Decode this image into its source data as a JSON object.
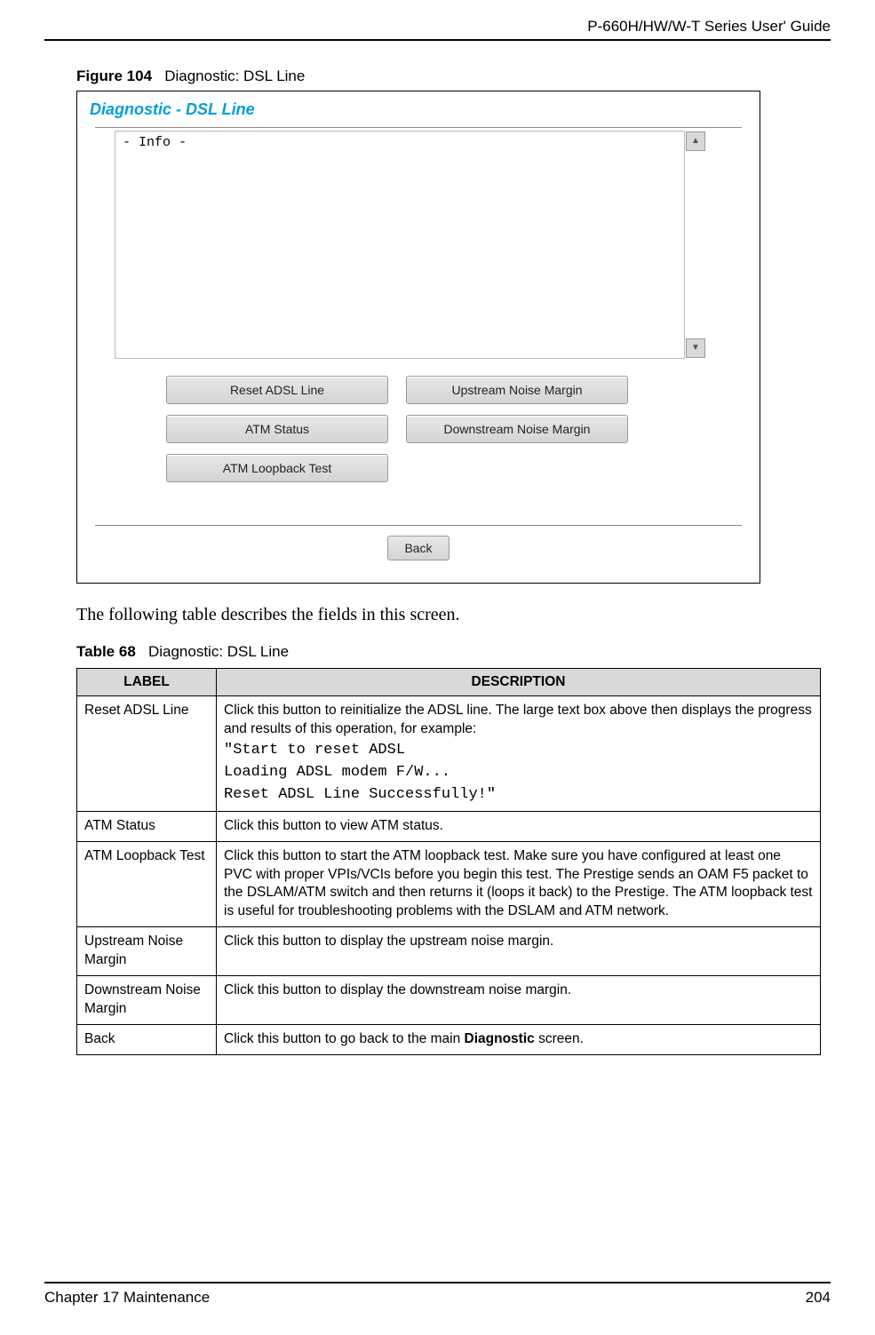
{
  "header": {
    "guide_title": "P-660H/HW/W-T Series User' Guide"
  },
  "figure": {
    "label": "Figure 104",
    "title": "Diagnostic: DSL Line",
    "panel_title": "Diagnostic - DSL Line",
    "info_text": "- Info -",
    "buttons": {
      "reset": "Reset ADSL Line",
      "upstream": "Upstream Noise Margin",
      "atm_status": "ATM Status",
      "downstream": "Downstream Noise Margin",
      "atm_loopback": "ATM Loopback Test",
      "back": "Back"
    },
    "scroll_up_glyph": "▲",
    "scroll_down_glyph": "▼"
  },
  "intro_text": "The following table describes the fields in this screen.",
  "table": {
    "label": "Table 68",
    "title": "Diagnostic: DSL Line",
    "headers": {
      "col1": "LABEL",
      "col2": "DESCRIPTION"
    },
    "rows": {
      "r0": {
        "label": "Reset ADSL Line",
        "desc_intro": "Click this button to reinitialize the ADSL line. The large text box above then displays the progress and results of this operation, for example:",
        "code1": "\"Start to reset ADSL",
        "code2": "Loading ADSL modem F/W...",
        "code3": "Reset ADSL Line Successfully!\""
      },
      "r1": {
        "label": "ATM Status",
        "desc": "Click this button to view ATM status."
      },
      "r2": {
        "label": "ATM Loopback Test",
        "desc": "Click this button to start the ATM loopback test. Make sure you have configured at least one PVC with proper VPIs/VCIs before you begin this test. The Prestige sends an OAM F5 packet to the DSLAM/ATM switch and then returns it (loops it back) to the Prestige. The ATM loopback test is useful for troubleshooting problems with the DSLAM and ATM network."
      },
      "r3": {
        "label": "Upstream Noise Margin",
        "desc": "Click this button to display the upstream noise margin."
      },
      "r4": {
        "label": "Downstream Noise Margin",
        "desc": "Click this button to display the downstream noise margin."
      },
      "r5": {
        "label": "Back",
        "desc_pre": "Click this button to go back to the main ",
        "desc_bold": "Diagnostic",
        "desc_post": " screen."
      }
    }
  },
  "footer": {
    "chapter": "Chapter 17 Maintenance",
    "page": "204"
  }
}
